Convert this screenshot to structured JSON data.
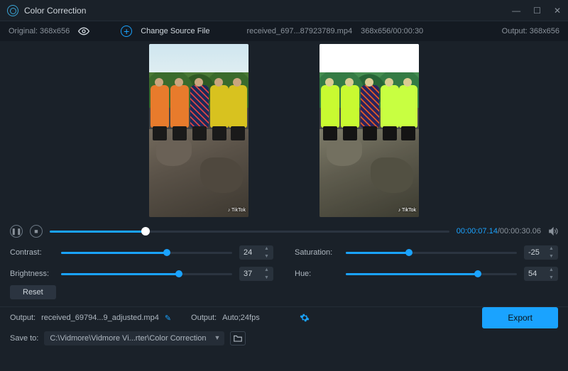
{
  "window": {
    "title": "Color Correction"
  },
  "topbar": {
    "original_label": "Original: 368x656",
    "change_source_label": "Change Source File",
    "filename": "received_697...87923789.mp4",
    "file_meta": "368x656/00:00:30",
    "output_label": "Output: 368x656"
  },
  "playbar": {
    "current_time": "00:00:07.14",
    "total_time": "/00:00:30.06"
  },
  "sliders": {
    "contrast": {
      "label": "Contrast:",
      "value": "24",
      "pct": 62
    },
    "brightness": {
      "label": "Brightness:",
      "value": "37",
      "pct": 69
    },
    "saturation": {
      "label": "Saturation:",
      "value": "-25",
      "pct": 37
    },
    "hue": {
      "label": "Hue:",
      "value": "54",
      "pct": 77
    }
  },
  "reset_label": "Reset",
  "output": {
    "label1": "Output:",
    "filename": "received_69794...9_adjusted.mp4",
    "label2": "Output:",
    "preset": "Auto;24fps"
  },
  "save": {
    "label": "Save to:",
    "path": "C:\\Vidmore\\Vidmore Vi...rter\\Color Correction"
  },
  "export_label": "Export"
}
